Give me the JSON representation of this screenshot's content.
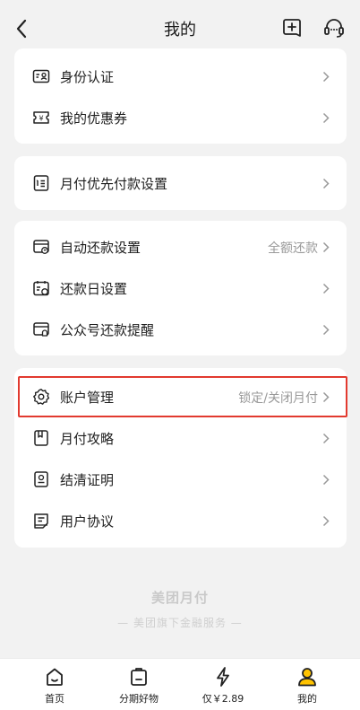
{
  "header": {
    "title": "我的",
    "back_icon": "chevron-left-icon",
    "add_icon": "add-box-icon",
    "service_icon": "headset-icon"
  },
  "groups": [
    {
      "items": [
        {
          "label": "身份认证",
          "icon": "id-card-icon",
          "value": ""
        },
        {
          "label": "我的优惠券",
          "icon": "coupon-icon",
          "value": ""
        }
      ]
    },
    {
      "items": [
        {
          "label": "月付优先付款设置",
          "icon": "priority-list-icon",
          "value": ""
        }
      ]
    },
    {
      "items": [
        {
          "label": "自动还款设置",
          "icon": "auto-repay-icon",
          "value": "全额还款"
        },
        {
          "label": "还款日设置",
          "icon": "calendar-icon",
          "value": ""
        },
        {
          "label": "公众号还款提醒",
          "icon": "reminder-icon",
          "value": ""
        }
      ]
    },
    {
      "items": [
        {
          "label": "账户管理",
          "icon": "gear-icon",
          "value": "锁定/关闭月付",
          "highlighted": true
        },
        {
          "label": "月付攻略",
          "icon": "bookmark-icon",
          "value": ""
        },
        {
          "label": "结清证明",
          "icon": "certificate-icon",
          "value": ""
        },
        {
          "label": "用户协议",
          "icon": "agreement-icon",
          "value": ""
        }
      ]
    }
  ],
  "footer": {
    "brand": "美团月付",
    "tagline": "— 美团旗下金融服务 —"
  },
  "tabbar": [
    {
      "label": "首页",
      "icon": "home-icon",
      "active": false
    },
    {
      "label": "分期好物",
      "icon": "shopping-bag-icon",
      "active": false
    },
    {
      "label": "仅￥2.89",
      "icon": "lightning-icon",
      "active": false
    },
    {
      "label": "我的",
      "icon": "user-icon",
      "active": true
    }
  ],
  "colors": {
    "accent": "#ffc300",
    "highlight_border": "#e23a2f",
    "page_bg": "#f2f2f2"
  }
}
